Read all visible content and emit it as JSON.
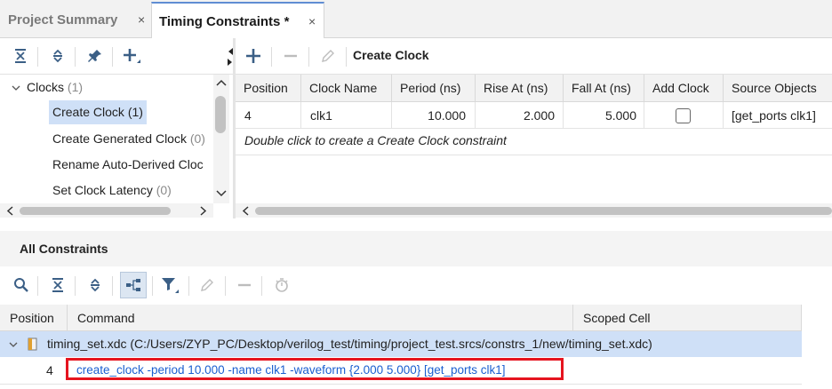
{
  "tabs": [
    {
      "label": "Project Summary",
      "active": false
    },
    {
      "label": "Timing Constraints *",
      "active": true
    }
  ],
  "tab_close_glyph": "×",
  "left_toolbar": {
    "icons": [
      "collapse-all-icon",
      "expand-all-icon",
      "pin-icon",
      "add-icon"
    ]
  },
  "right_toolbar": {
    "icons": [
      "add-icon",
      "remove-icon",
      "edit-icon"
    ],
    "title": "Create Clock"
  },
  "tree": {
    "group_label": "Clocks",
    "group_count": "(1)",
    "items": [
      {
        "label": "Create Clock",
        "count": "(1)",
        "selected": true
      },
      {
        "label": "Create Generated Clock",
        "count": "(0)",
        "selected": false
      },
      {
        "label": "Rename Auto-Derived Cloc",
        "count": "",
        "selected": false
      },
      {
        "label": "Set Clock Latency",
        "count": "(0)",
        "selected": false
      }
    ]
  },
  "clock_table": {
    "columns": [
      "Position",
      "Clock Name",
      "Period (ns)",
      "Rise At (ns)",
      "Fall At (ns)",
      "Add Clock",
      "Source Objects"
    ],
    "rows": [
      {
        "position": "4",
        "clock_name": "clk1",
        "period": "10.000",
        "rise_at": "2.000",
        "fall_at": "5.000",
        "add_clock": false,
        "source_objects": "[get_ports clk1]"
      }
    ],
    "hint": "Double click to create a Create Clock constraint"
  },
  "all_constraints": {
    "title": "All Constraints",
    "toolbar_icons": [
      "search-icon",
      "collapse-all-icon",
      "expand-all-icon",
      "hierarchy-icon",
      "filter-icon",
      "edit-icon",
      "remove-icon",
      "timer-icon"
    ],
    "columns": [
      "Position",
      "Command",
      "Scoped Cell"
    ],
    "file_row": {
      "label": "timing_set.xdc (C:/Users/ZYP_PC/Desktop/verilog_test/timing/project_test.srcs/constrs_1/new/timing_set.xdc)"
    },
    "rows": [
      {
        "position": "4",
        "command": "create_clock -period 10.000 -name clk1 -waveform {2.000 5.000} [get_ports clk1]",
        "scoped_cell": ""
      }
    ]
  },
  "colors": {
    "selection": "#cfe0f7",
    "link": "#1a5fd0",
    "highlight_box": "#e5141f",
    "active_tab_border": "#5f8dd3"
  }
}
